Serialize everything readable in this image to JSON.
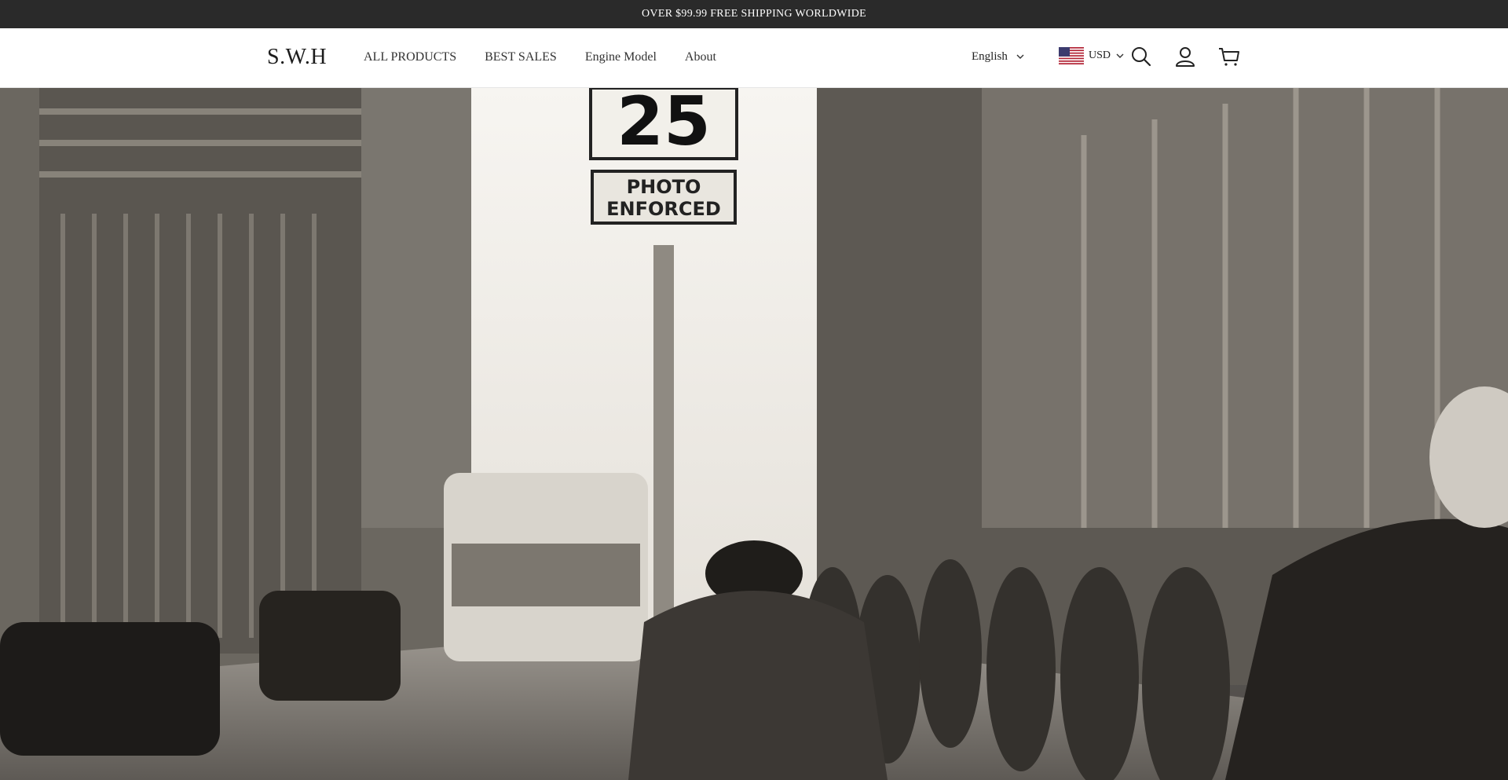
{
  "announcement": {
    "text": "OVER $99.99 FREE SHIPPING WORLDWIDE"
  },
  "header": {
    "logo": "S.W.H",
    "nav": [
      "ALL PRODUCTS",
      "BEST SALES",
      "Engine Model",
      "About"
    ],
    "language": "English",
    "currency": "USD"
  },
  "icons": {
    "search": "search-icon",
    "account": "user-icon",
    "cart": "cart-icon",
    "flag": "us-flag-icon"
  },
  "hero": {
    "sign_speed": "25",
    "sign_line1": "PHOTO",
    "sign_line2": "ENFORCED"
  },
  "colors": {
    "announcement_bg": "#2a2a2a",
    "announcement_text": "#ffffff",
    "header_bg": "#ffffff",
    "text": "#222222"
  }
}
